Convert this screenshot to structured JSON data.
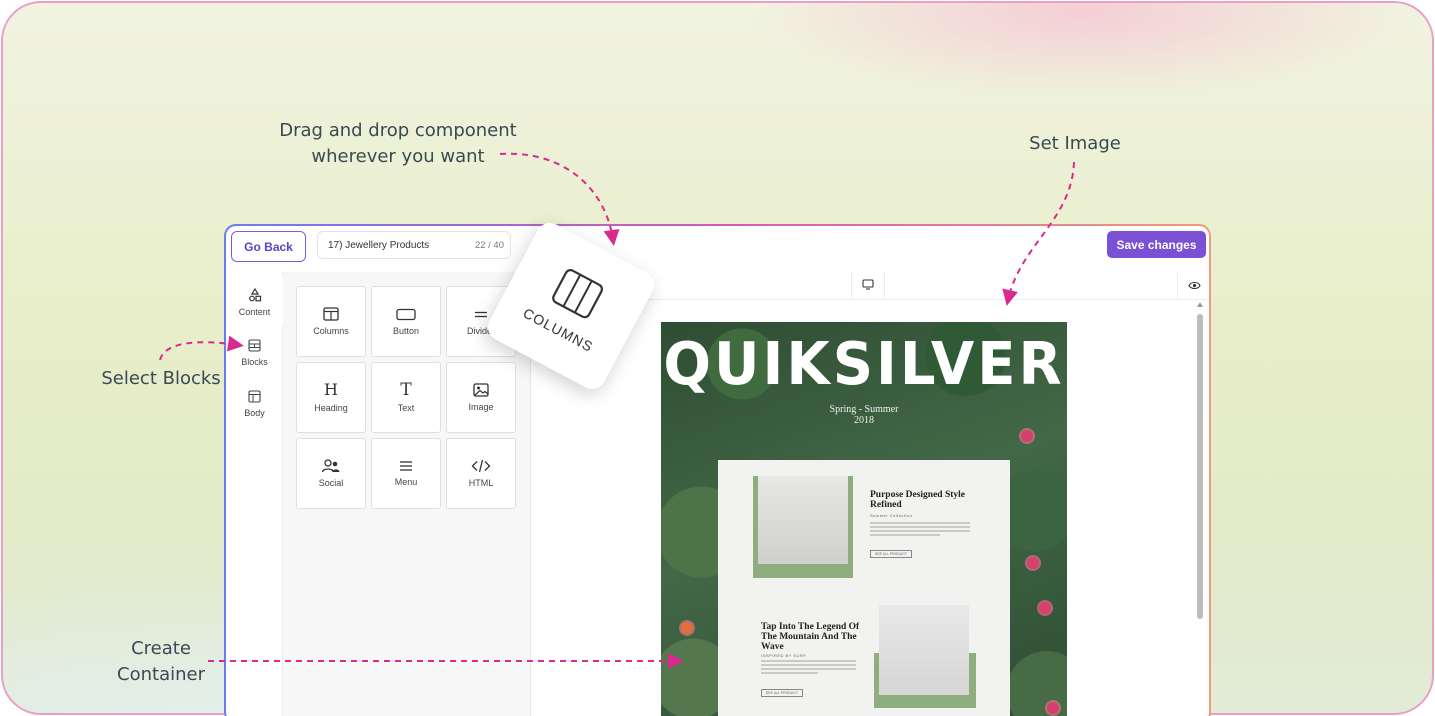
{
  "annotations": {
    "drag_drop": [
      "Drag and drop component",
      "wherever you want"
    ],
    "set_image": "Set Image",
    "select_blocks": "Select Blocks",
    "create_container": [
      "Create",
      "Container"
    ]
  },
  "topbar": {
    "go_back": "Go Back",
    "document_name": "17) Jewellery Products",
    "document_count": "22 / 40",
    "save_label": "Save changes"
  },
  "sidebar": {
    "items": [
      {
        "label": "Content",
        "icon": "shapes-icon"
      },
      {
        "label": "Blocks",
        "icon": "blocks-icon"
      },
      {
        "label": "Body",
        "icon": "layout-icon"
      }
    ]
  },
  "tiles": [
    {
      "label": "Columns",
      "icon": "columns-icon"
    },
    {
      "label": "Button",
      "icon": "button-icon"
    },
    {
      "label": "Divider",
      "icon": "divider-icon"
    },
    {
      "label": "Heading",
      "icon": "heading-icon"
    },
    {
      "label": "Text",
      "icon": "text-icon"
    },
    {
      "label": "Image",
      "icon": "image-icon"
    },
    {
      "label": "Social",
      "icon": "social-icon"
    },
    {
      "label": "Menu",
      "icon": "menu-icon"
    },
    {
      "label": "HTML",
      "icon": "code-icon"
    }
  ],
  "drag_card": {
    "label": "COLUMNS",
    "icon": "columns-icon"
  },
  "email": {
    "brand": "QUIKSILVER",
    "season_line1": "Spring - Summer",
    "season_line2": "2018",
    "product1": {
      "title": "Purpose Designed Style Refined",
      "subtitle": "Summer Collection",
      "button": "SEE ALL PRODUCT"
    },
    "product2": {
      "title": "Tap Into The Legend Of The Mountain And The Wave",
      "subtitle": "INSPIRED BY SURF",
      "button": "SEE ALL PRODUCT"
    }
  },
  "colors": {
    "accent": "#7a50d4",
    "annotation_arrow": "#d92a8f"
  }
}
